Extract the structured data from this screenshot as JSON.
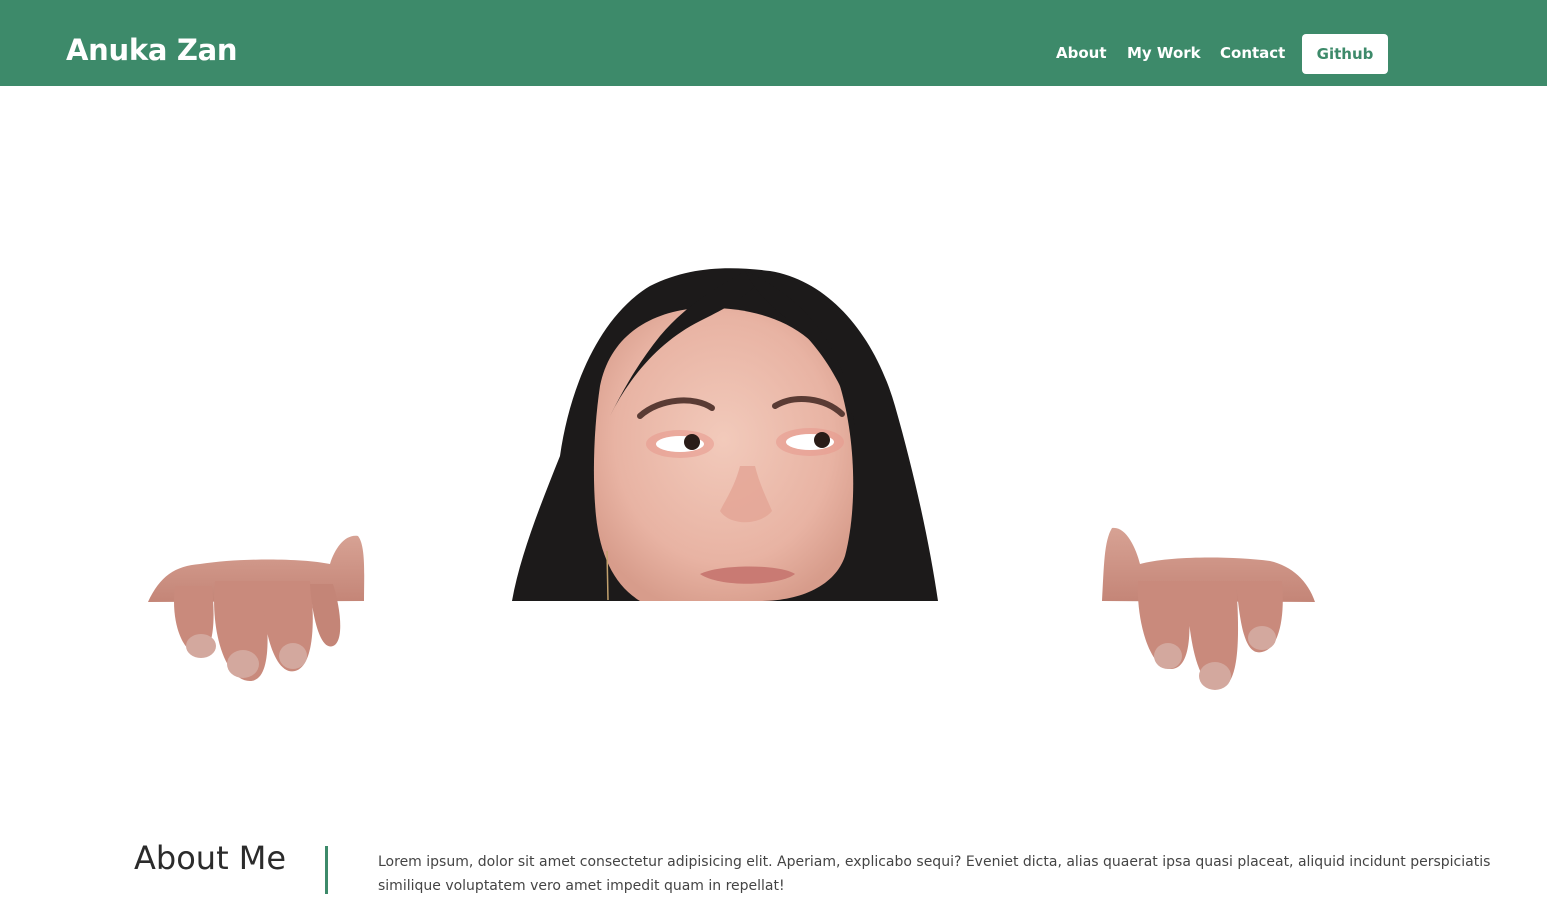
{
  "navbar": {
    "brand": "Anuka Zan",
    "links": [
      {
        "label": "About"
      },
      {
        "label": "My Work"
      },
      {
        "label": "Contact"
      }
    ],
    "github_label": "Github",
    "background_color": "#3d8a6a"
  },
  "hero": {
    "image": "portrait-peeking-over-edge"
  },
  "about": {
    "heading": "About Me",
    "text": "Lorem ipsum, dolor sit amet consectetur adipisicing elit. Aperiam, explicabo sequi? Eveniet dicta, alias quaerat ipsa quasi placeat, aliquid incidunt perspiciatis similique voluptatem vero amet impedit quam in repellat!",
    "accent_color": "#3d8a6a"
  }
}
